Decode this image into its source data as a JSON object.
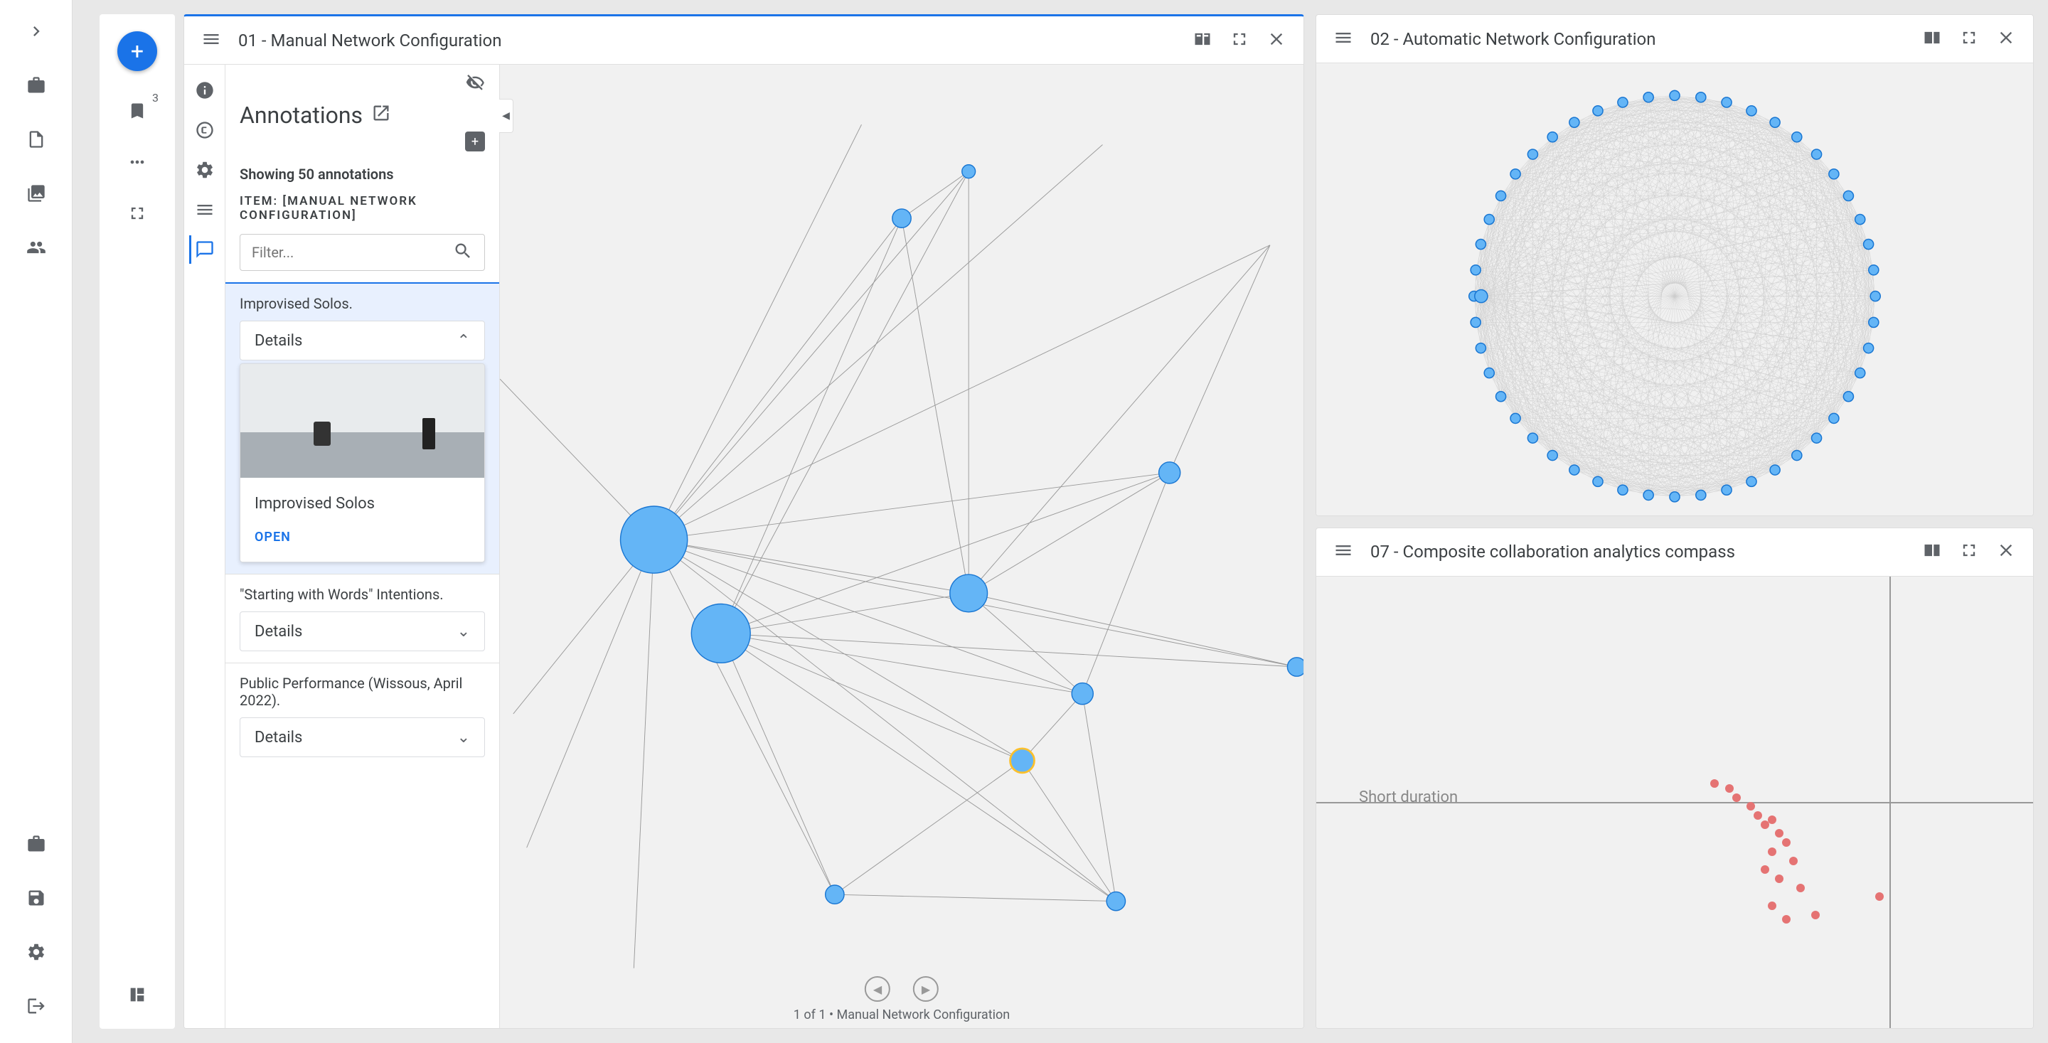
{
  "left_toolbar": {
    "bookmark_badge": "3"
  },
  "panel1": {
    "title": "01 - Manual Network Configuration",
    "annotations_title": "Annotations",
    "showing_count": "Showing 50 annotations",
    "item_label": "ITEM: [MANUAL NETWORK CONFIGURATION]",
    "filter_placeholder": "Filter...",
    "cards": [
      {
        "title": "Improvised Solos.",
        "details_label": "Details",
        "expanded_title": "Improvised Solos",
        "open_label": "OPEN"
      },
      {
        "title": "\"Starting with Words\" Intentions.",
        "details_label": "Details"
      },
      {
        "title": "Public Performance (Wissous, April 2022).",
        "details_label": "Details"
      }
    ],
    "footer_caption": "1 of 1 • Manual Network Configuration"
  },
  "panel2": {
    "title": "02 - Automatic Network Configuration"
  },
  "panel3": {
    "title": "07 - Composite collaboration analytics compass",
    "axis_label": "Short duration"
  }
}
